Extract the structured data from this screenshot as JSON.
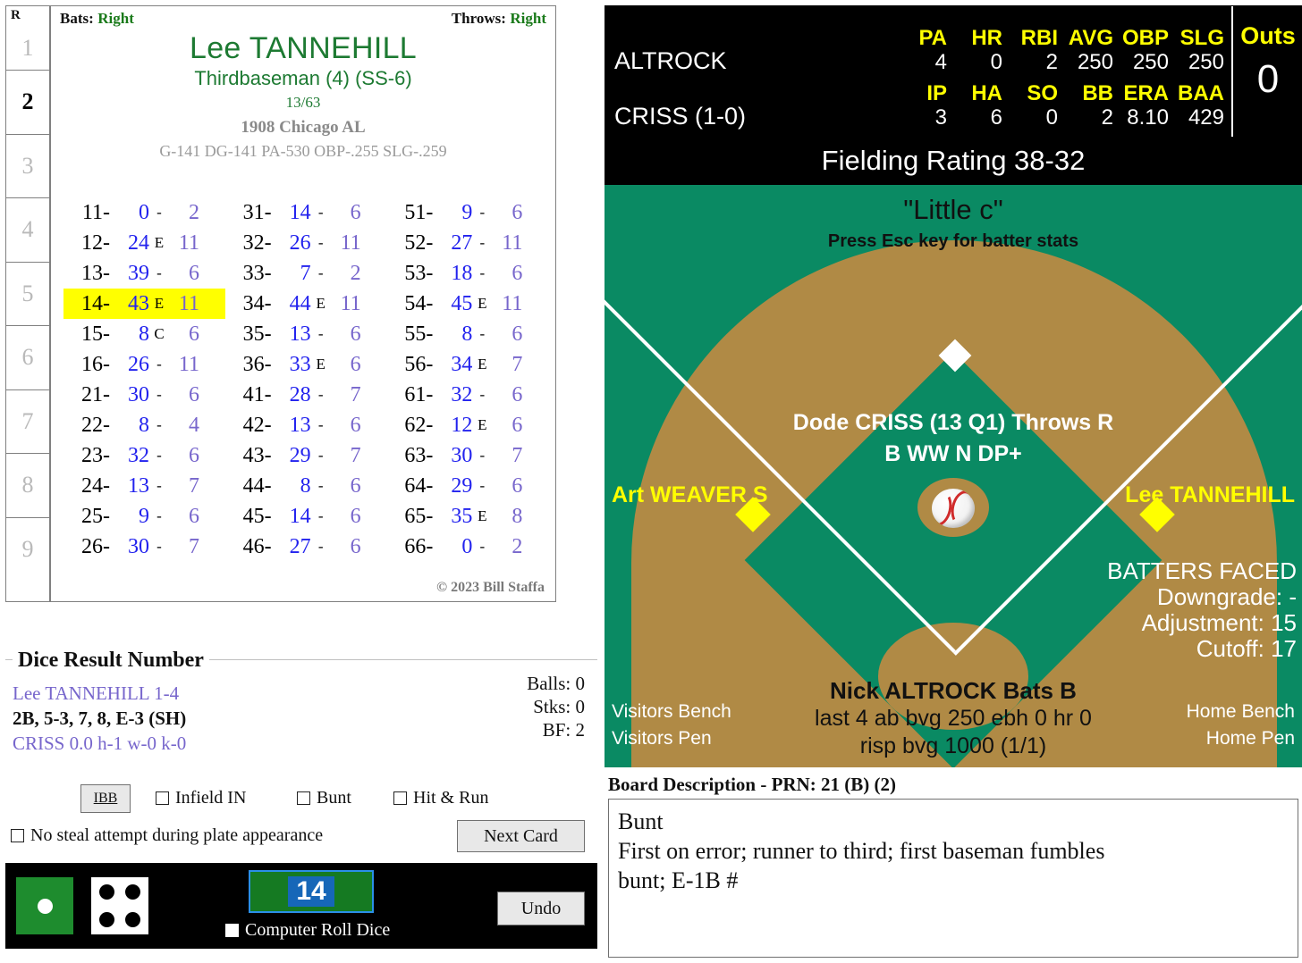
{
  "innings": {
    "header": "R",
    "numbers": [
      "1",
      "2",
      "3",
      "4",
      "5",
      "6",
      "7",
      "8",
      "9"
    ],
    "current": "2"
  },
  "player_card": {
    "bats_label": "Bats:",
    "bats_value": "Right",
    "throws_label": "Throws:",
    "throws_value": "Right",
    "name": "Lee TANNEHILL",
    "position": "Thirdbaseman (4) (SS-6)",
    "ratio": "13/63",
    "team": "1908 Chicago AL",
    "stats": "G-141 DG-141 PA-530 OBP-.255 SLG-.259",
    "copyright": "© 2023 Bill Staffa",
    "result_columns": [
      [
        {
          "dice": "11-",
          "num": "0",
          "mid": "-",
          "alt": "2"
        },
        {
          "dice": "12-",
          "num": "24",
          "mid": "E",
          "alt": "11"
        },
        {
          "dice": "13-",
          "num": "39",
          "mid": "-",
          "alt": "6"
        },
        {
          "dice": "14-",
          "num": "43",
          "mid": "E",
          "alt": "11",
          "highlight": true
        },
        {
          "dice": "15-",
          "num": "8",
          "mid": "C",
          "alt": "6"
        },
        {
          "dice": "16-",
          "num": "26",
          "mid": "-",
          "alt": "11"
        },
        {
          "dice": "21-",
          "num": "30",
          "mid": "-",
          "alt": "6"
        },
        {
          "dice": "22-",
          "num": "8",
          "mid": "-",
          "alt": "4"
        },
        {
          "dice": "23-",
          "num": "32",
          "mid": "-",
          "alt": "6"
        },
        {
          "dice": "24-",
          "num": "13",
          "mid": "-",
          "alt": "7"
        },
        {
          "dice": "25-",
          "num": "9",
          "mid": "-",
          "alt": "6"
        },
        {
          "dice": "26-",
          "num": "30",
          "mid": "-",
          "alt": "7"
        }
      ],
      [
        {
          "dice": "31-",
          "num": "14",
          "mid": "-",
          "alt": "6"
        },
        {
          "dice": "32-",
          "num": "26",
          "mid": "-",
          "alt": "11"
        },
        {
          "dice": "33-",
          "num": "7",
          "mid": "-",
          "alt": "2"
        },
        {
          "dice": "34-",
          "num": "44",
          "mid": "E",
          "alt": "11"
        },
        {
          "dice": "35-",
          "num": "13",
          "mid": "-",
          "alt": "6"
        },
        {
          "dice": "36-",
          "num": "33",
          "mid": "E",
          "alt": "6"
        },
        {
          "dice": "41-",
          "num": "28",
          "mid": "-",
          "alt": "7"
        },
        {
          "dice": "42-",
          "num": "13",
          "mid": "-",
          "alt": "6"
        },
        {
          "dice": "43-",
          "num": "29",
          "mid": "-",
          "alt": "7"
        },
        {
          "dice": "44-",
          "num": "8",
          "mid": "-",
          "alt": "6"
        },
        {
          "dice": "45-",
          "num": "14",
          "mid": "-",
          "alt": "6"
        },
        {
          "dice": "46-",
          "num": "27",
          "mid": "-",
          "alt": "6"
        }
      ],
      [
        {
          "dice": "51-",
          "num": "9",
          "mid": "-",
          "alt": "6"
        },
        {
          "dice": "52-",
          "num": "27",
          "mid": "-",
          "alt": "11"
        },
        {
          "dice": "53-",
          "num": "18",
          "mid": "-",
          "alt": "6"
        },
        {
          "dice": "54-",
          "num": "45",
          "mid": "E",
          "alt": "11"
        },
        {
          "dice": "55-",
          "num": "8",
          "mid": "-",
          "alt": "6"
        },
        {
          "dice": "56-",
          "num": "34",
          "mid": "E",
          "alt": "7"
        },
        {
          "dice": "61-",
          "num": "32",
          "mid": "-",
          "alt": "6"
        },
        {
          "dice": "62-",
          "num": "12",
          "mid": "E",
          "alt": "6"
        },
        {
          "dice": "63-",
          "num": "30",
          "mid": "-",
          "alt": "7"
        },
        {
          "dice": "64-",
          "num": "29",
          "mid": "-",
          "alt": "6"
        },
        {
          "dice": "65-",
          "num": "35",
          "mid": "E",
          "alt": "8"
        },
        {
          "dice": "66-",
          "num": "0",
          "mid": "-",
          "alt": "2"
        }
      ]
    ]
  },
  "dice_result": {
    "title": "Dice Result Number",
    "line1": "Lee TANNEHILL  1-4",
    "line2": "2B, 5-3, 7, 8, E-3 (SH)",
    "line3": "CRISS 0.0 h-1 w-0 k-0",
    "balls": "Balls: 0",
    "strikes": "Stks: 0",
    "bf": "BF: 2"
  },
  "controls": {
    "ibb_label": "IBB",
    "infield_in": "Infield IN",
    "bunt": "Bunt",
    "hit_and_run": "Hit & Run",
    "no_steal": "No steal attempt during plate appearance",
    "next_card": "Next Card",
    "computer_roll": "Computer Roll Dice",
    "undo": "Undo",
    "roll_value": "14",
    "die1_pips": 1,
    "die2_pips": 4
  },
  "scoreboard": {
    "batter_name": "ALTROCK",
    "pitcher_name": "CRISS (1-0)",
    "batting_headers": [
      "PA",
      "HR",
      "RBI",
      "AVG",
      "OBP",
      "SLG"
    ],
    "batting_values": [
      "4",
      "0",
      "2",
      "250",
      "250",
      "250"
    ],
    "pitching_headers": [
      "IP",
      "HA",
      "SO",
      "BB",
      "ERA",
      "BAA"
    ],
    "pitching_values": [
      "3",
      "6",
      "0",
      "2",
      "8.10",
      "429"
    ],
    "outs_label": "Outs",
    "outs_value": "0",
    "fielding_rating": "Fielding Rating 38-32"
  },
  "field": {
    "park_name": "\"Little c\"",
    "esc_hint": "Press Esc key for batter stats",
    "pitcher_line1": "Dode CRISS (13 Q1) Throws R",
    "pitcher_line2": "B WW N DP+",
    "fielder_left": "Art WEAVER S",
    "fielder_right": "Lee TANNEHILL",
    "batters_faced_title": "BATTERS FACED",
    "downgrade": "Downgrade: -",
    "adjustment": "Adjustment: 15",
    "cutoff": "Cutoff: 17",
    "batter_name": "Nick ALTROCK Bats B",
    "batter_line1": "last 4 ab bvg 250 ebh 0 hr 0",
    "batter_line2": "risp bvg 1000 (1/1)",
    "visitors_bench": "Visitors Bench",
    "visitors_pen": "Visitors Pen",
    "home_bench": "Home Bench",
    "home_pen": "Home Pen"
  },
  "board": {
    "title": "Board Description - PRN: 21 (B) (2)",
    "lines": [
      "Bunt",
      "First on error; runner to third; first baseman fumbles",
      "bunt; E-1B #"
    ]
  },
  "colors": {
    "field_green": "#0a8a63",
    "dirt_tan": "#b08a45",
    "accent_yellow": "#ffff00",
    "card_green": "#1d7a32",
    "dice_number_blue": "#2222ee",
    "alt_purple": "#7766cc"
  }
}
